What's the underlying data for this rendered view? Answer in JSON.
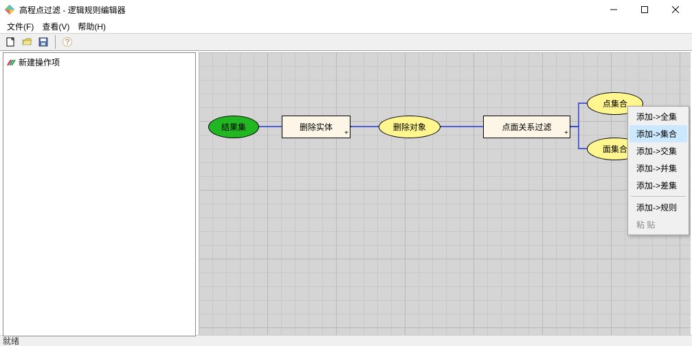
{
  "window": {
    "title": "高程点过滤 - 逻辑规则编辑器"
  },
  "menu": {
    "file": "文件(F)",
    "view": "查看(V)",
    "help": "帮助(H)"
  },
  "tree": {
    "root": "新建操作项"
  },
  "nodes": {
    "result": "结果集",
    "delEnt": "删除实体",
    "delObj": "删除对象",
    "filter": "点面关系过滤",
    "ptSet": "点集合",
    "faceSet": "面集合"
  },
  "context_menu": {
    "add_all": "添加->全集",
    "add_set": "添加->集合",
    "add_inter": "添加->交集",
    "add_union": "添加->并集",
    "add_diff": "添加->差集",
    "add_rule": "添加->规则",
    "paste": "粘  贴"
  },
  "status": "就绪"
}
